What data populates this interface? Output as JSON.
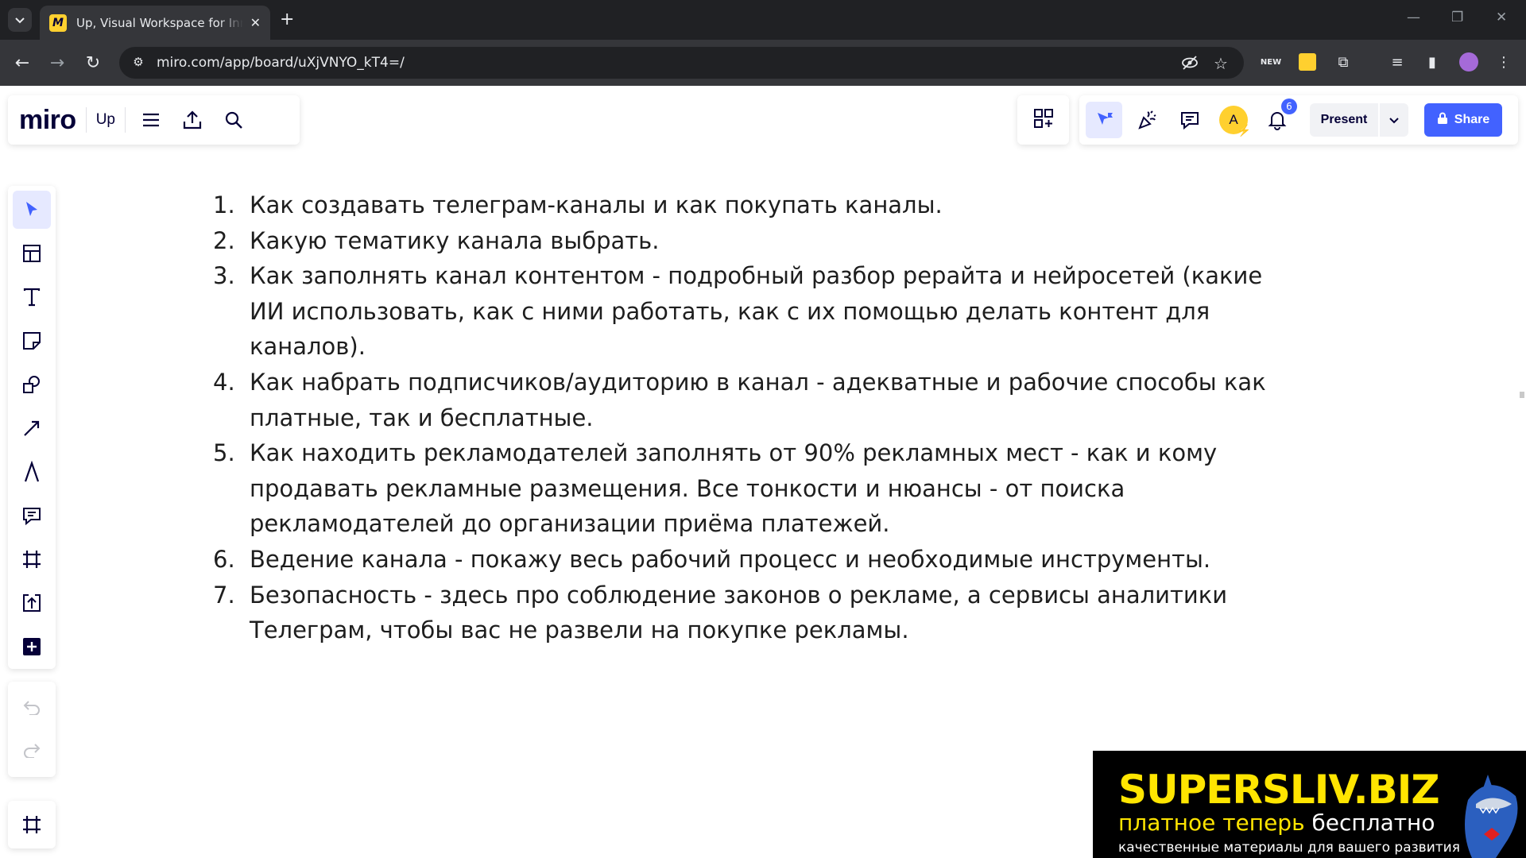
{
  "browser": {
    "tab_title": "Up, Visual Workspace for Innovation",
    "favicon_letter": "M",
    "url": "miro.com/app/board/uXjVNYO_kT4=/"
  },
  "app": {
    "logo": "miro",
    "board_name": "Up",
    "present_label": "Present",
    "share_label": "Share",
    "avatar_initial": "A",
    "notifications_count": "6",
    "accent_color": "#4262ff"
  },
  "content": {
    "items": [
      {
        "num": "1.",
        "text": "Как создавать телеграм-каналы и как покупать каналы."
      },
      {
        "num": "2.",
        "text": "Какую тематику канала выбрать."
      },
      {
        "num": "3.",
        "text": "Как заполнять канал контентом - подробный разбор рерайта и нейросетей (какие ИИ использовать, как с ними работать, как с их помощью делать контент для каналов)."
      },
      {
        "num": "4.",
        "text": "Как набрать подписчиков/аудиторию в канал - адекватные и рабочие способы как платные, так и бесплатные."
      },
      {
        "num": "5.",
        "text": "Как находить рекламодателей заполнять от 90% рекламных мест - как и кому продавать рекламные размещения. Все тонкости и нюансы - от поиска рекламодателей до организации приёма платежей."
      },
      {
        "num": "6.",
        "text": "Ведение канала - покажу весь рабочий процесс и необходимые инструменты."
      },
      {
        "num": "7.",
        "text": "Безопасность - здесь про соблюдение законов о рекламе, а сервисы аналитики Телеграм, чтобы вас не развели на покупке рекламы."
      }
    ]
  },
  "watermark": {
    "brand": "SUPERSLIV.BIZ",
    "tagline_paid": "платное теперь",
    "tagline_free": "бесплатно",
    "subtitle": "качественные материалы для вашего развития"
  }
}
